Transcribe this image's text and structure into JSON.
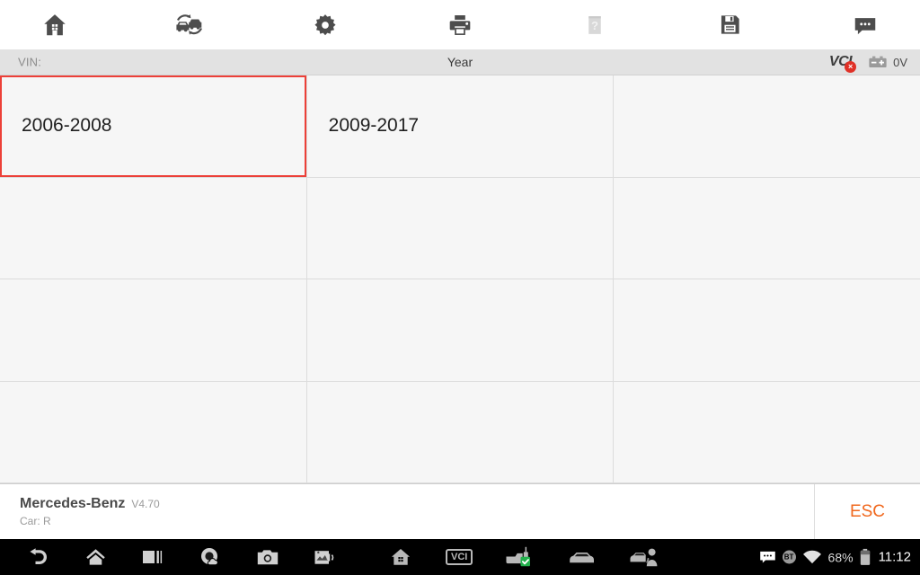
{
  "toolbar": {
    "items": [
      {
        "name": "home-icon",
        "label": "Home",
        "disabled": false
      },
      {
        "name": "vehicle-swap-icon",
        "label": "Vehicle Swap",
        "disabled": false
      },
      {
        "name": "gear-icon",
        "label": "Settings",
        "disabled": false
      },
      {
        "name": "printer-icon",
        "label": "Print",
        "disabled": false
      },
      {
        "name": "help-icon",
        "label": "Help",
        "disabled": true
      },
      {
        "name": "save-icon",
        "label": "Save",
        "disabled": false
      },
      {
        "name": "message-icon",
        "label": "Message",
        "disabled": false
      }
    ]
  },
  "infobar": {
    "vin_label": "VIN:",
    "vin_value": "",
    "title": "Year",
    "vci_label": "VCI",
    "vci_status": "disconnected",
    "vci_badge": "×",
    "battery_voltage": "0V"
  },
  "grid": {
    "columns": 3,
    "rows": 4,
    "selected_index": 0,
    "cells": [
      {
        "label": "2006-2008",
        "selected": true
      },
      {
        "label": "2009-2017",
        "selected": false
      },
      {
        "label": "",
        "selected": false
      },
      {
        "label": "",
        "selected": false
      },
      {
        "label": "",
        "selected": false
      },
      {
        "label": "",
        "selected": false
      },
      {
        "label": "",
        "selected": false
      },
      {
        "label": "",
        "selected": false
      },
      {
        "label": "",
        "selected": false
      },
      {
        "label": "",
        "selected": false
      },
      {
        "label": "",
        "selected": false
      },
      {
        "label": "",
        "selected": false
      }
    ]
  },
  "footer": {
    "vehicle_name": "Mercedes-Benz",
    "version": "V4.70",
    "car_line": "Car: R",
    "esc_label": "ESC"
  },
  "navbar": {
    "left_icons": [
      {
        "name": "back-icon",
        "label": "Back"
      },
      {
        "name": "home-icon",
        "label": "Home"
      },
      {
        "name": "recents-icon",
        "label": "Recent Apps"
      },
      {
        "name": "cloud-capture-icon",
        "label": "Cloud Capture"
      },
      {
        "name": "camera-icon",
        "label": "Screenshot"
      },
      {
        "name": "mute-icon",
        "label": "Sound"
      },
      {
        "name": "app-home-icon",
        "label": "App Home"
      },
      {
        "name": "vci-icon",
        "label": "VCI"
      },
      {
        "name": "vci-connected-icon",
        "label": "VCI Connected"
      },
      {
        "name": "car-icon",
        "label": "Vehicle"
      },
      {
        "name": "mechanic-icon",
        "label": "Service"
      }
    ],
    "vci_nav_label": "VCI",
    "bluetooth_label": "BT",
    "battery_percent": "68%",
    "time": "11:12"
  },
  "colors": {
    "selection_red": "#ec4038",
    "esc_orange": "#f0681e",
    "vci_badge_red": "#e03127",
    "check_green": "#22b14c",
    "infobar_bg": "#e2e2e2",
    "cell_bg": "#f6f6f6",
    "grid_line": "#dcdcdc"
  }
}
